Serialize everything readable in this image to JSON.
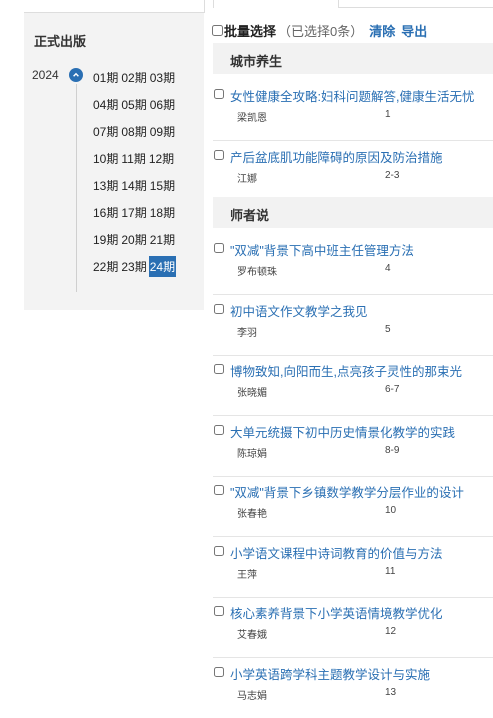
{
  "left": {
    "title": "正式出版",
    "year": "2024",
    "issue_rows": [
      [
        "01期",
        "02期",
        "03期"
      ],
      [
        "04期",
        "05期",
        "06期"
      ],
      [
        "07期",
        "08期",
        "09期"
      ],
      [
        "10期",
        "11期",
        "12期"
      ],
      [
        "13期",
        "14期",
        "15期"
      ],
      [
        "16期",
        "17期",
        "18期"
      ],
      [
        "19期",
        "20期",
        "21期"
      ],
      [
        "22期",
        "23期",
        "24期"
      ]
    ],
    "active_issue": "24期"
  },
  "batch": {
    "label": "批量选择",
    "count": "（已选择0条）",
    "clear": "清除",
    "export": "导出"
  },
  "sections": [
    {
      "name": "城市养生",
      "articles": [
        {
          "title": "女性健康全攻略:妇科问题解答,健康生活无忧",
          "author": "梁凯恩",
          "pages": "1"
        },
        {
          "title": "产后盆底肌功能障碍的原因及防治措施",
          "author": "江娜",
          "pages": "2-3"
        }
      ]
    },
    {
      "name": "师者说",
      "articles": [
        {
          "title": "\"双减\"背景下高中班主任管理方法",
          "author": "罗布顿珠",
          "pages": "4"
        },
        {
          "title": "初中语文作文教学之我见",
          "author": "李羽",
          "pages": "5"
        },
        {
          "title": "博物致知,向阳而生,点亮孩子灵性的那束光",
          "author": "张晓媚",
          "pages": "6-7"
        },
        {
          "title": "大单元统摄下初中历史情景化教学的实践",
          "author": "陈琼娟",
          "pages": "8-9"
        },
        {
          "title": "\"双减\"背景下乡镇数学教学分层作业的设计",
          "author": "张春艳",
          "pages": "10"
        },
        {
          "title": "小学语文课程中诗词教育的价值与方法",
          "author": "王萍",
          "pages": "11"
        },
        {
          "title": "核心素养背景下小学英语情境教学优化",
          "author": "艾春娥",
          "pages": "12"
        },
        {
          "title": "小学英语跨学科主题教学设计与实施",
          "author": "马志娟",
          "pages": "13"
        }
      ]
    }
  ],
  "colors": {
    "link": "#2a6fb3",
    "active_bg": "#2a6fb3",
    "panel_bg": "#f3f3f3",
    "section_bg": "#f2f2f2"
  },
  "icons": {
    "year_toggle": "chevron-up-icon"
  }
}
